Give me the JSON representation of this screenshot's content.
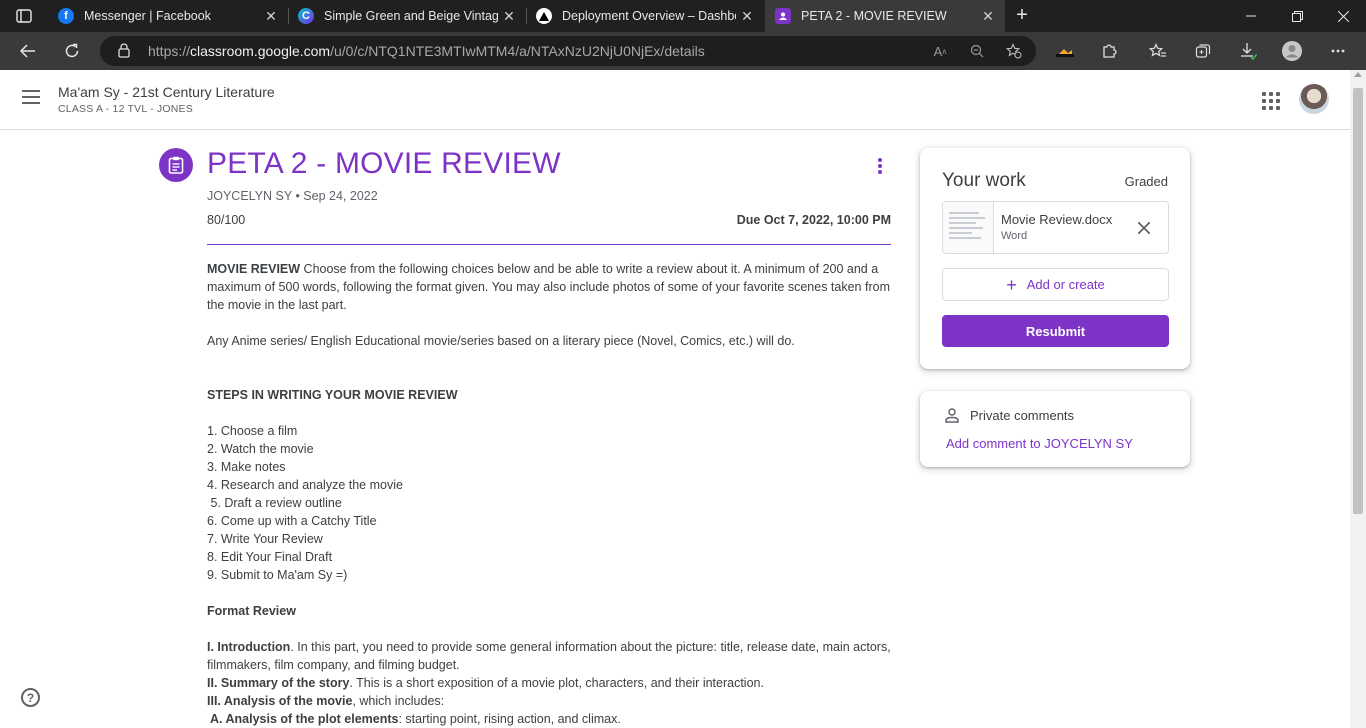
{
  "browser": {
    "tabs": [
      {
        "title": "Messenger | Facebook",
        "icon": "facebook-icon",
        "active": false
      },
      {
        "title": "Simple Green and Beige Vintage",
        "icon": "canva-icon",
        "active": false
      },
      {
        "title": "Deployment Overview – Dashboa",
        "icon": "vercel-icon",
        "active": false
      },
      {
        "title": "PETA 2 - MOVIE REVIEW",
        "icon": "classroom-icon",
        "active": true
      }
    ],
    "close_glyph": "✕",
    "new_tab_glyph": "+",
    "url_prefix": "https://",
    "url_domain": "classroom.google.com",
    "url_path": "/u/0/c/NTQ1NTE3MTIwMTM4/a/NTAxNzU2NjU0NjEx/details"
  },
  "header": {
    "class_title": "Ma'am Sy - 21st Century Literature",
    "class_subtitle": "CLASS A - 12 TVL - JONES"
  },
  "assignment": {
    "title": "PETA 2 - MOVIE REVIEW",
    "author_date": "JOYCELYN SY • Sep 24, 2022",
    "points": "80/100",
    "due": "Due Oct 7, 2022, 10:00 PM",
    "intro_bold": "MOVIE REVIEW",
    "intro_text": " Choose from the following choices below and be able to write a review about it. A minimum of 200 and a maximum of 500 words, following the format given. You may also include photos of some of your favorite scenes taken from the movie in the last part.",
    "any_text": "Any Anime series/ English Educational movie/series based on a literary piece (Novel, Comics, etc.) will do.",
    "steps_heading": "STEPS IN WRITING YOUR MOVIE REVIEW",
    "steps": [
      "1. Choose a film",
      "2. Watch the movie",
      "3. Make notes",
      "4. Research and analyze the movie",
      " 5. Draft a review outline",
      "6. Come up with a Catchy Title",
      "7. Write Your Review",
      "8. Edit Your Final Draft",
      "9. Submit to Ma'am Sy =)"
    ],
    "format_heading": "Format Review",
    "format": [
      {
        "bold": "I. Introduction",
        "text": ". In this part, you need to provide some general information about the picture: title, release date, main actors, filmmakers, film company, and filming budget."
      },
      {
        "bold": "II. Summary of the story",
        "text": ". This is a short exposition of a movie plot, characters, and their interaction."
      },
      {
        "bold": "III. Analysis of the movie",
        "text": ", which includes:"
      },
      {
        "bold": " A. Analysis of the plot elements",
        "text": ": starting point, rising action, and climax."
      }
    ]
  },
  "your_work": {
    "title": "Your work",
    "status": "Graded",
    "file_name": "Movie Review.docx",
    "file_type": "Word",
    "add_label": "Add or create",
    "resubmit_label": "Resubmit"
  },
  "private_comments": {
    "title": "Private comments",
    "link": "Add comment to JOYCELYN SY"
  },
  "colors": {
    "accent": "#7e33c7",
    "chrome_dark": "#202020",
    "chrome_bar": "#3a3a3a"
  }
}
